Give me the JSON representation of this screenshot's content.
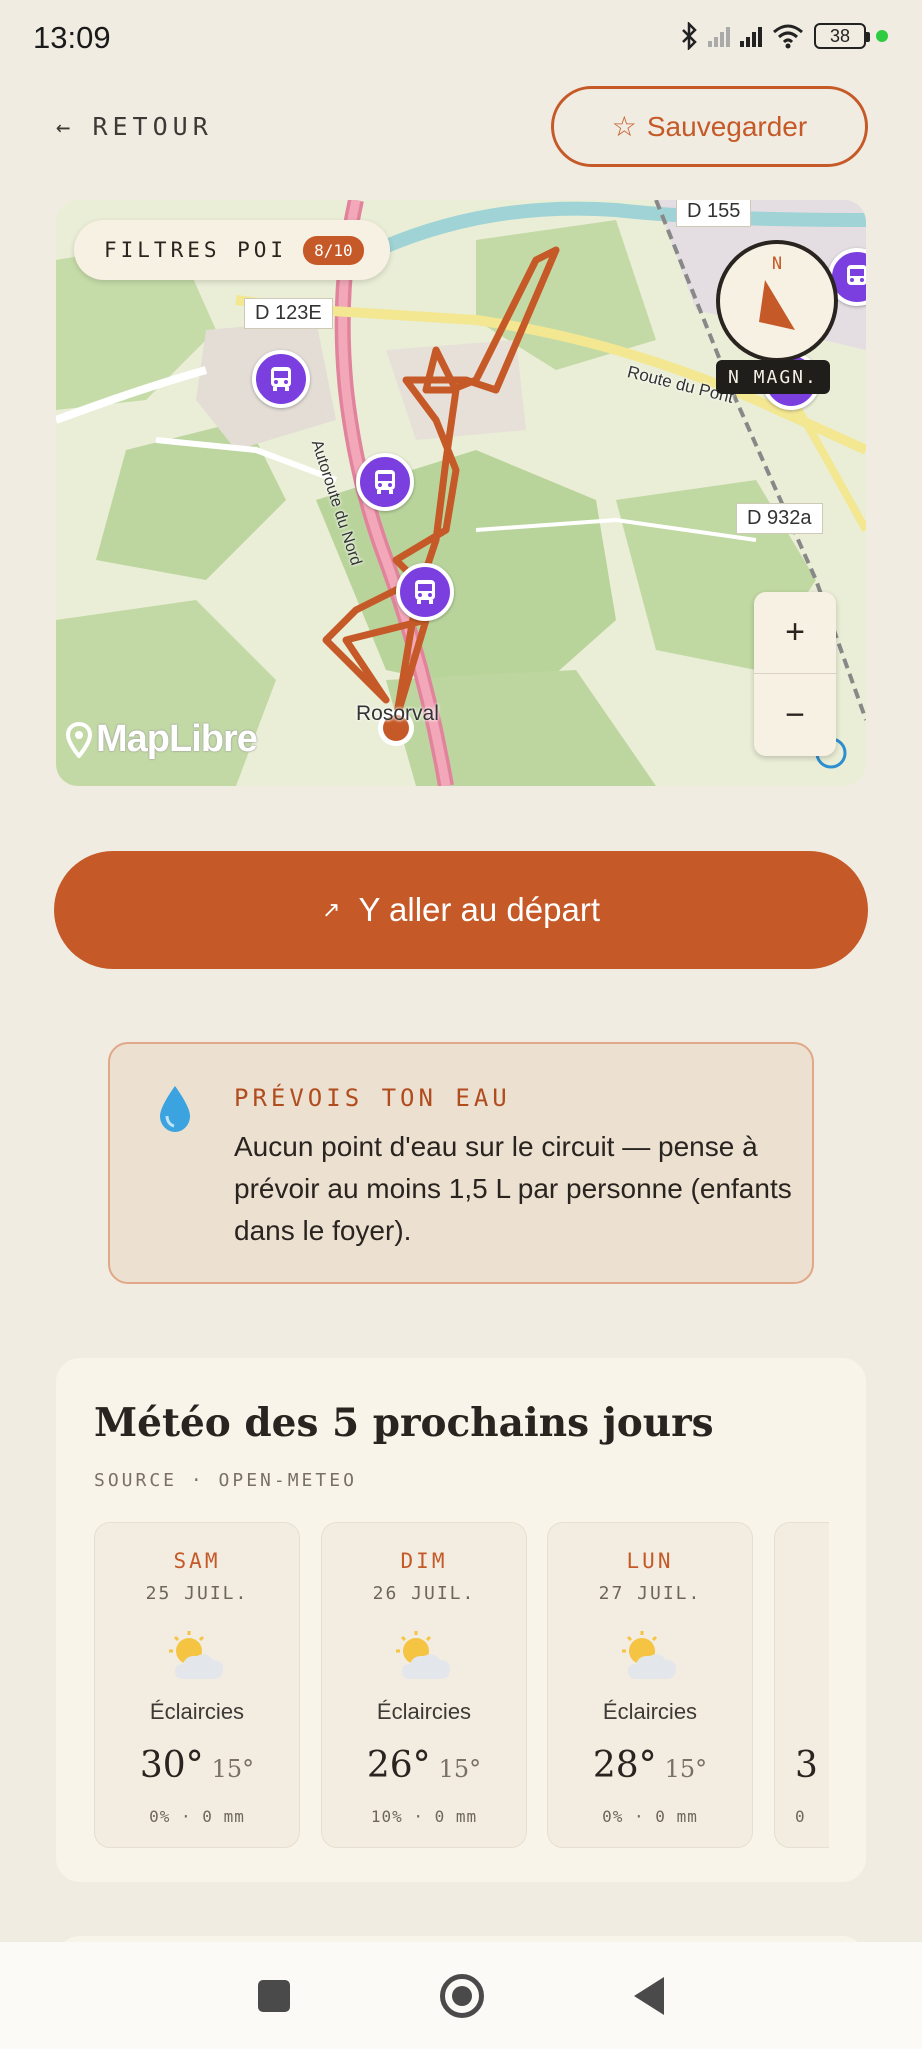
{
  "status_bar": {
    "time": "13:09",
    "battery": "38",
    "icons": [
      "bluetooth-icon",
      "signal-icon",
      "signal-icon",
      "wifi-icon",
      "battery-icon"
    ]
  },
  "header": {
    "back_arrow": "←",
    "back_label": "RETOUR",
    "save_icon": "☆",
    "save_label": "Sauvegarder"
  },
  "map": {
    "poi_filter_label": "FILTRES POI",
    "poi_filter_count": "8/10",
    "compass_letter": "N",
    "north_mode": "N MAGN.",
    "zoom_in": "+",
    "zoom_out": "−",
    "attribution": "MapLibre",
    "labels": {
      "d155": "D 155",
      "d123e": "D 123E",
      "d932a": "D 932a",
      "route_du_pont": "Route du Pont",
      "place_start": "Rosorval",
      "autoroute": "Autoroute du Nord"
    },
    "colors": {
      "route": "#c55a28",
      "poi": "#7b3fe0"
    }
  },
  "cta": {
    "icon": "↗",
    "label": "Y aller au départ"
  },
  "water": {
    "icon": "droplet-icon",
    "title": "PRÉVOIS TON EAU",
    "body": "Aucun point d'eau sur le circuit — pense à prévoir au moins 1,5 L par personne (enfants dans le foyer)."
  },
  "meteo": {
    "title": "Météo des 5 prochains jours",
    "source": "SOURCE · OPEN-METEO",
    "days": [
      {
        "day": "SAM",
        "date": "25 JUIL.",
        "icon": "partly-cloudy-icon",
        "condition": "Éclaircies",
        "high": "30°",
        "low": "15°",
        "rain": "0% · 0 mm"
      },
      {
        "day": "DIM",
        "date": "26 JUIL.",
        "icon": "partly-cloudy-icon",
        "condition": "Éclaircies",
        "high": "26°",
        "low": "15°",
        "rain": "10% · 0 mm"
      },
      {
        "day": "LUN",
        "date": "27 JUIL.",
        "icon": "partly-cloudy-icon",
        "condition": "Éclaircies",
        "high": "28°",
        "low": "15°",
        "rain": "0% · 0 mm"
      },
      {
        "day": "",
        "date": "",
        "icon": "partly-cloudy-icon",
        "condition": "",
        "high": "3",
        "low": "",
        "rain": "0"
      }
    ]
  },
  "colors": {
    "accent": "#c55a28",
    "background": "#f1ece2"
  }
}
